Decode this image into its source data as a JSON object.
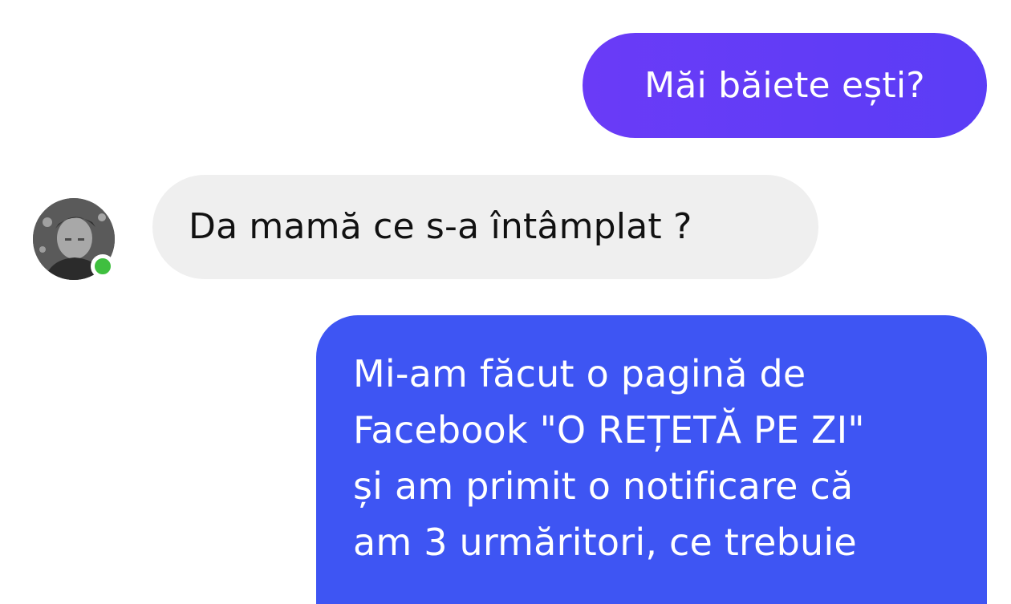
{
  "conversation": {
    "messages": [
      {
        "sender": "me",
        "text": "Măi băiete ești?"
      },
      {
        "sender": "contact",
        "text": "Da mamă ce s-a întâmplat ?"
      },
      {
        "sender": "me",
        "lines": [
          "Mi-am făcut o pagină de",
          "Facebook \"O REȚETĂ PE ZI\"",
          "și am primit o notificare că",
          "am 3 urmăritori,  ce trebuie"
        ]
      }
    ]
  },
  "contact": {
    "avatar_icon": "user-avatar",
    "online": true,
    "presence_color": "#3fbf3f"
  },
  "colors": {
    "outgoing_bubble_1": "#6a3bf7",
    "outgoing_bubble_2": "#3e55f3",
    "incoming_bubble": "#efefef"
  }
}
